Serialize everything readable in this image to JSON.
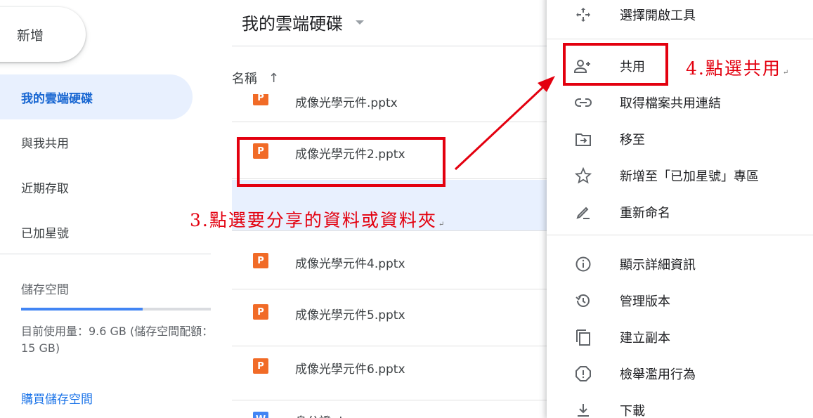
{
  "sidebar": {
    "new_label": "新增",
    "items": [
      {
        "label": "我的雲端硬碟"
      },
      {
        "label": "與我共用"
      },
      {
        "label": "近期存取"
      },
      {
        "label": "已加星號"
      }
    ],
    "storage": {
      "title": "儲存空間",
      "usage_fraction": 0.64,
      "usage_text": "目前使用量：9.6 GB (儲存空間配額：15 GB)",
      "buy_label": "購買儲存空間"
    }
  },
  "main": {
    "title": "我的雲端硬碟",
    "column_name": "名稱",
    "sort_arrow": "↑",
    "files": [
      {
        "name": "成像光學元件.pptx",
        "icon": "P"
      },
      {
        "name": "成像光學元件2.pptx",
        "icon": "P"
      },
      {
        "name": "成像光學元件4.pptx",
        "icon": "P"
      },
      {
        "name": "成像光學元件5.pptx",
        "icon": "P"
      },
      {
        "name": "成像光學元件6.pptx",
        "icon": "P"
      },
      {
        "name": "身分證.docx",
        "icon": "W"
      }
    ]
  },
  "context_menu": {
    "items": [
      {
        "label": "選擇開啟工具",
        "icon": "open-with-icon"
      },
      {
        "label": "共用",
        "icon": "add-person-icon"
      },
      {
        "label": "取得檔案共用連結",
        "icon": "link-icon"
      },
      {
        "label": "移至",
        "icon": "move-to-folder-icon"
      },
      {
        "label": "新增至「已加星號」專區",
        "icon": "star-icon"
      },
      {
        "label": "重新命名",
        "icon": "pencil-icon"
      },
      {
        "label": "顯示詳細資訊",
        "icon": "info-icon"
      },
      {
        "label": "管理版本",
        "icon": "history-icon"
      },
      {
        "label": "建立副本",
        "icon": "copy-icon"
      },
      {
        "label": "檢舉濫用行為",
        "icon": "report-icon"
      },
      {
        "label": "下載",
        "icon": "download-icon"
      }
    ]
  },
  "annotations": {
    "step3": "3.點選要分享的資料或資料夾",
    "step4": "4.點選共用",
    "return_mark": "↵",
    "color": "#e3000f"
  }
}
